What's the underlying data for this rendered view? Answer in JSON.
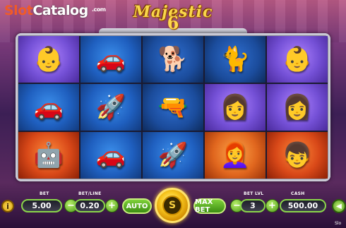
{
  "watermark": {
    "part1": "Slot",
    "part2": "Catalog",
    "suffix": ".com"
  },
  "logo": {
    "title": "Majestic",
    "number": "6"
  },
  "reels": [
    [
      "baby",
      "car",
      "robot-dog",
      "siamese-cat",
      "baby"
    ],
    [
      "car",
      "rocket",
      "ray-gun",
      "purple-hair-girl",
      "purple-hair-girl"
    ],
    [
      "red-robot",
      "car",
      "rocket",
      "red-hair-heroine",
      "orange-hair-boy"
    ]
  ],
  "symbol_glyphs": {
    "baby": "👶",
    "car": "🚗",
    "robot-dog": "🐕",
    "siamese-cat": "🐈",
    "rocket": "🚀",
    "ray-gun": "🔫",
    "purple-hair-girl": "👩",
    "red-robot": "🤖",
    "red-hair-heroine": "👩‍🦰",
    "orange-hair-boy": "👦"
  },
  "symbol_backgrounds": {
    "baby": "c-purple",
    "car": "c-blue",
    "robot-dog": "c-dblue",
    "siamese-cat": "c-dblue",
    "rocket": "c-blue",
    "ray-gun": "c-dblue",
    "purple-hair-girl": "c-purple",
    "red-robot": "c-red",
    "red-hair-heroine": "c-orange",
    "orange-hair-boy": "c-red"
  },
  "controls": {
    "bet_label": "BET",
    "bet_value": "5.00",
    "betline_label": "BET/LINE",
    "betline_value": "0.20",
    "minus": "−",
    "plus": "+",
    "auto_label": "AUTO",
    "spin_label": "S",
    "maxbet_label": "MAX BET",
    "betlvl_label": "BET LVL",
    "betlvl_value": "3",
    "cash_label": "CASH",
    "cash_value": "500.00",
    "info_symbol": "i",
    "sound_symbol": "◀",
    "corner_text": "Slo"
  },
  "colors": {
    "accent": "#8ad64a",
    "spin": "#f8c820"
  }
}
